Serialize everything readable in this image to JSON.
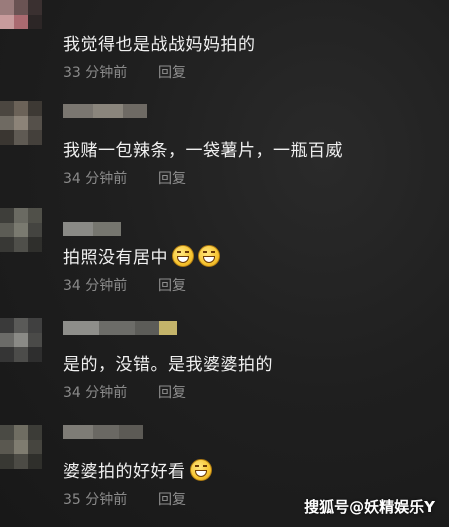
{
  "colors": {
    "background": "#1c1c1c",
    "text": "#f0f0f0",
    "meta": "#8a8a8a"
  },
  "comments": [
    {
      "text": "我觉得也是战战妈妈拍的",
      "time": "33 分钟前",
      "reply": "回复",
      "emojis": []
    },
    {
      "text": "我赌一包辣条，一袋薯片，一瓶百威",
      "time": "34 分钟前",
      "reply": "回复",
      "emojis": []
    },
    {
      "text": "拍照没有居中",
      "time": "34 分钟前",
      "reply": "回复",
      "emojis": [
        "grin-emoji",
        "grin-emoji"
      ]
    },
    {
      "text": "是的，没错。是我婆婆拍的",
      "time": "34 分钟前",
      "reply": "回复",
      "emojis": []
    },
    {
      "text": "婆婆拍的好好看",
      "time": "35 分钟前",
      "reply": "回复",
      "emojis": [
        "grin-emoji"
      ]
    }
  ],
  "watermark": "搜狐号@妖精娱乐Y"
}
